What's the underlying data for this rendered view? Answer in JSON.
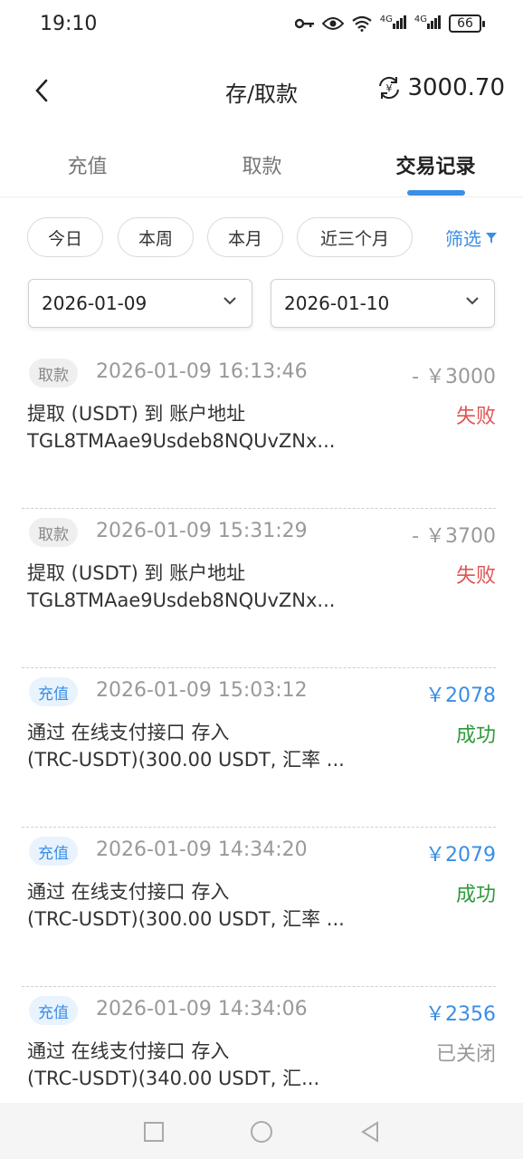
{
  "status_bar": {
    "time": "19:10",
    "battery": "66",
    "signal1": "4G",
    "signal2": "4G"
  },
  "header": {
    "title": "存/取款",
    "balance": "3000.70",
    "back_icon": "chevron-left-icon",
    "refresh_icon": "yen-refresh-icon"
  },
  "tabs": [
    {
      "label": "充值"
    },
    {
      "label": "取款"
    },
    {
      "label": "交易记录"
    }
  ],
  "quick_filters": [
    {
      "label": "今日"
    },
    {
      "label": "本周"
    },
    {
      "label": "本月"
    },
    {
      "label": "近三个月"
    }
  ],
  "filter_label": "筛选",
  "date_range": {
    "start": "2026-01-09",
    "end": "2026-01-10"
  },
  "records": [
    {
      "type": "取款",
      "time": "2026-01-09 16:13:46",
      "amount": "- ￥3000",
      "desc1": "提取 (USDT) 到 账户地址",
      "desc2": "TGL8TMAae9Usdeb8NQUvZNx...",
      "status": "失败"
    },
    {
      "type": "取款",
      "time": "2026-01-09 15:31:29",
      "amount": "- ￥3700",
      "desc1": "提取 (USDT) 到 账户地址",
      "desc2": "TGL8TMAae9Usdeb8NQUvZNx...",
      "status": "失败"
    },
    {
      "type": "充值",
      "time": "2026-01-09 15:03:12",
      "amount": "￥2078",
      "desc1": "通过 在线支付接口 存入",
      "desc2": "(TRC-USDT)(300.00 USDT, 汇率 ...",
      "status": "成功"
    },
    {
      "type": "充值",
      "time": "2026-01-09 14:34:20",
      "amount": "￥2079",
      "desc1": "通过 在线支付接口 存入",
      "desc2": "(TRC-USDT)(300.00 USDT, 汇率 ...",
      "status": "成功"
    },
    {
      "type": "充值",
      "time": "2026-01-09 14:34:06",
      "amount": "￥2356",
      "desc1": "通过 在线支付接口 存入",
      "desc2": "(TRC-USDT)(340.00 USDT, 汇...",
      "status": "已关闭"
    }
  ],
  "colors": {
    "accent": "#3a8ee6",
    "fail": "#e05454",
    "success": "#2e9a3a",
    "muted": "#999999"
  }
}
